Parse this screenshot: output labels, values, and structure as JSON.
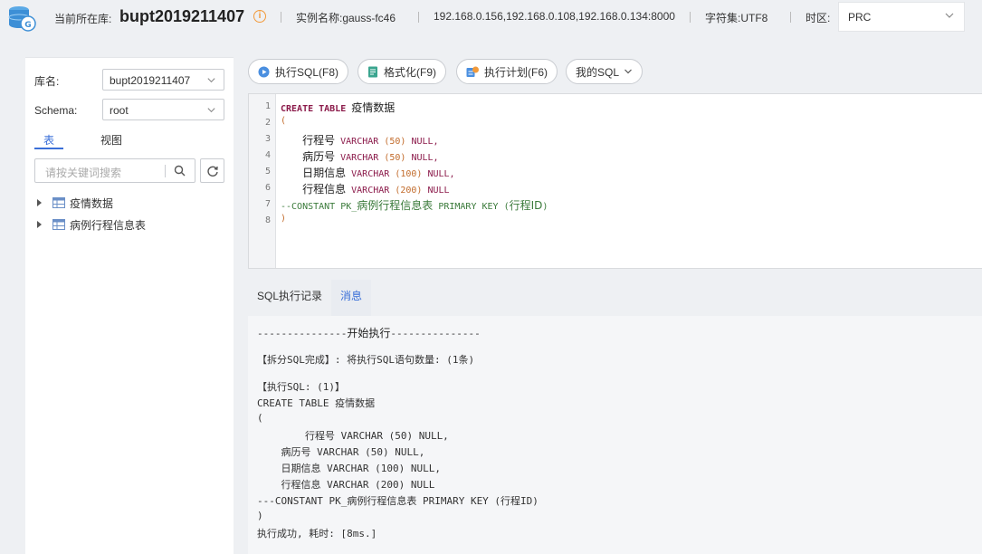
{
  "header": {
    "current_db_label": "当前所在库:",
    "current_db": "bupt2019211407",
    "instance": "实例名称:gauss-fc46",
    "hosts": "192.168.0.156,192.168.0.108,192.168.0.134:8000",
    "charset": "字符集:UTF8",
    "timezone_label": "时区:",
    "timezone_value": "PRC"
  },
  "sidebar": {
    "db_label": "库名:",
    "db_value": "bupt2019211407",
    "schema_label": "Schema:",
    "schema_value": "root",
    "tabs": [
      "表",
      "视图"
    ],
    "search_placeholder": "请按关键词搜索",
    "tables": [
      "疫情数据",
      "病例行程信息表"
    ]
  },
  "toolbar": {
    "execute": "执行SQL(F8)",
    "format": "格式化(F9)",
    "plan": "执行计划(F6)",
    "my_sql": "我的SQL"
  },
  "editor": {
    "line_numbers": [
      "1",
      "2",
      "3",
      "4",
      "5",
      "6",
      "7",
      "8"
    ],
    "l1_kw": "CREATE TABLE ",
    "l1_name": "疫情数据",
    "l2": "(",
    "l3_col": "行程号",
    "l3_type": "VARCHAR",
    "l3_num": "(50)",
    "l3_null": "NULL,",
    "l4_col": "病历号",
    "l4_type": "VARCHAR",
    "l4_num": "(50)",
    "l4_null": "NULL,",
    "l5_col": "日期信息",
    "l5_type": "VARCHAR",
    "l5_num": "(100)",
    "l5_null": "NULL,",
    "l6_col": "行程信息",
    "l6_type": "VARCHAR",
    "l6_num": "(200)",
    "l6_null": "NULL",
    "l7_a": "--CONSTANT PK_",
    "l7_b": "病例行程信息表",
    "l7_c": " PRIMARY KEY (",
    "l7_d": "行程ID",
    "l7_e": ")",
    "l8": ")"
  },
  "bottom_tabs": [
    "SQL执行记录",
    "消息"
  ],
  "messages": {
    "start_a": "---------------",
    "start_b": "开始执行",
    "start_c": "---------------",
    "split": "【拆分SQL完成】: 将执行SQL语句数量: (1条)",
    "exec": "【执行SQL: (1)】",
    "m1": "CREATE TABLE 疫情数据",
    "m2": "(",
    "m3": "        行程号 VARCHAR (50) NULL,",
    "m4": "    病历号 VARCHAR (50) NULL,",
    "m5": "    日期信息 VARCHAR (100) NULL,",
    "m6": "    行程信息 VARCHAR (200) NULL",
    "m7": "---CONSTANT PK_病例行程信息表 PRIMARY KEY (行程ID)",
    "m8": ")",
    "success": "执行成功, 耗时: [8ms.]"
  }
}
